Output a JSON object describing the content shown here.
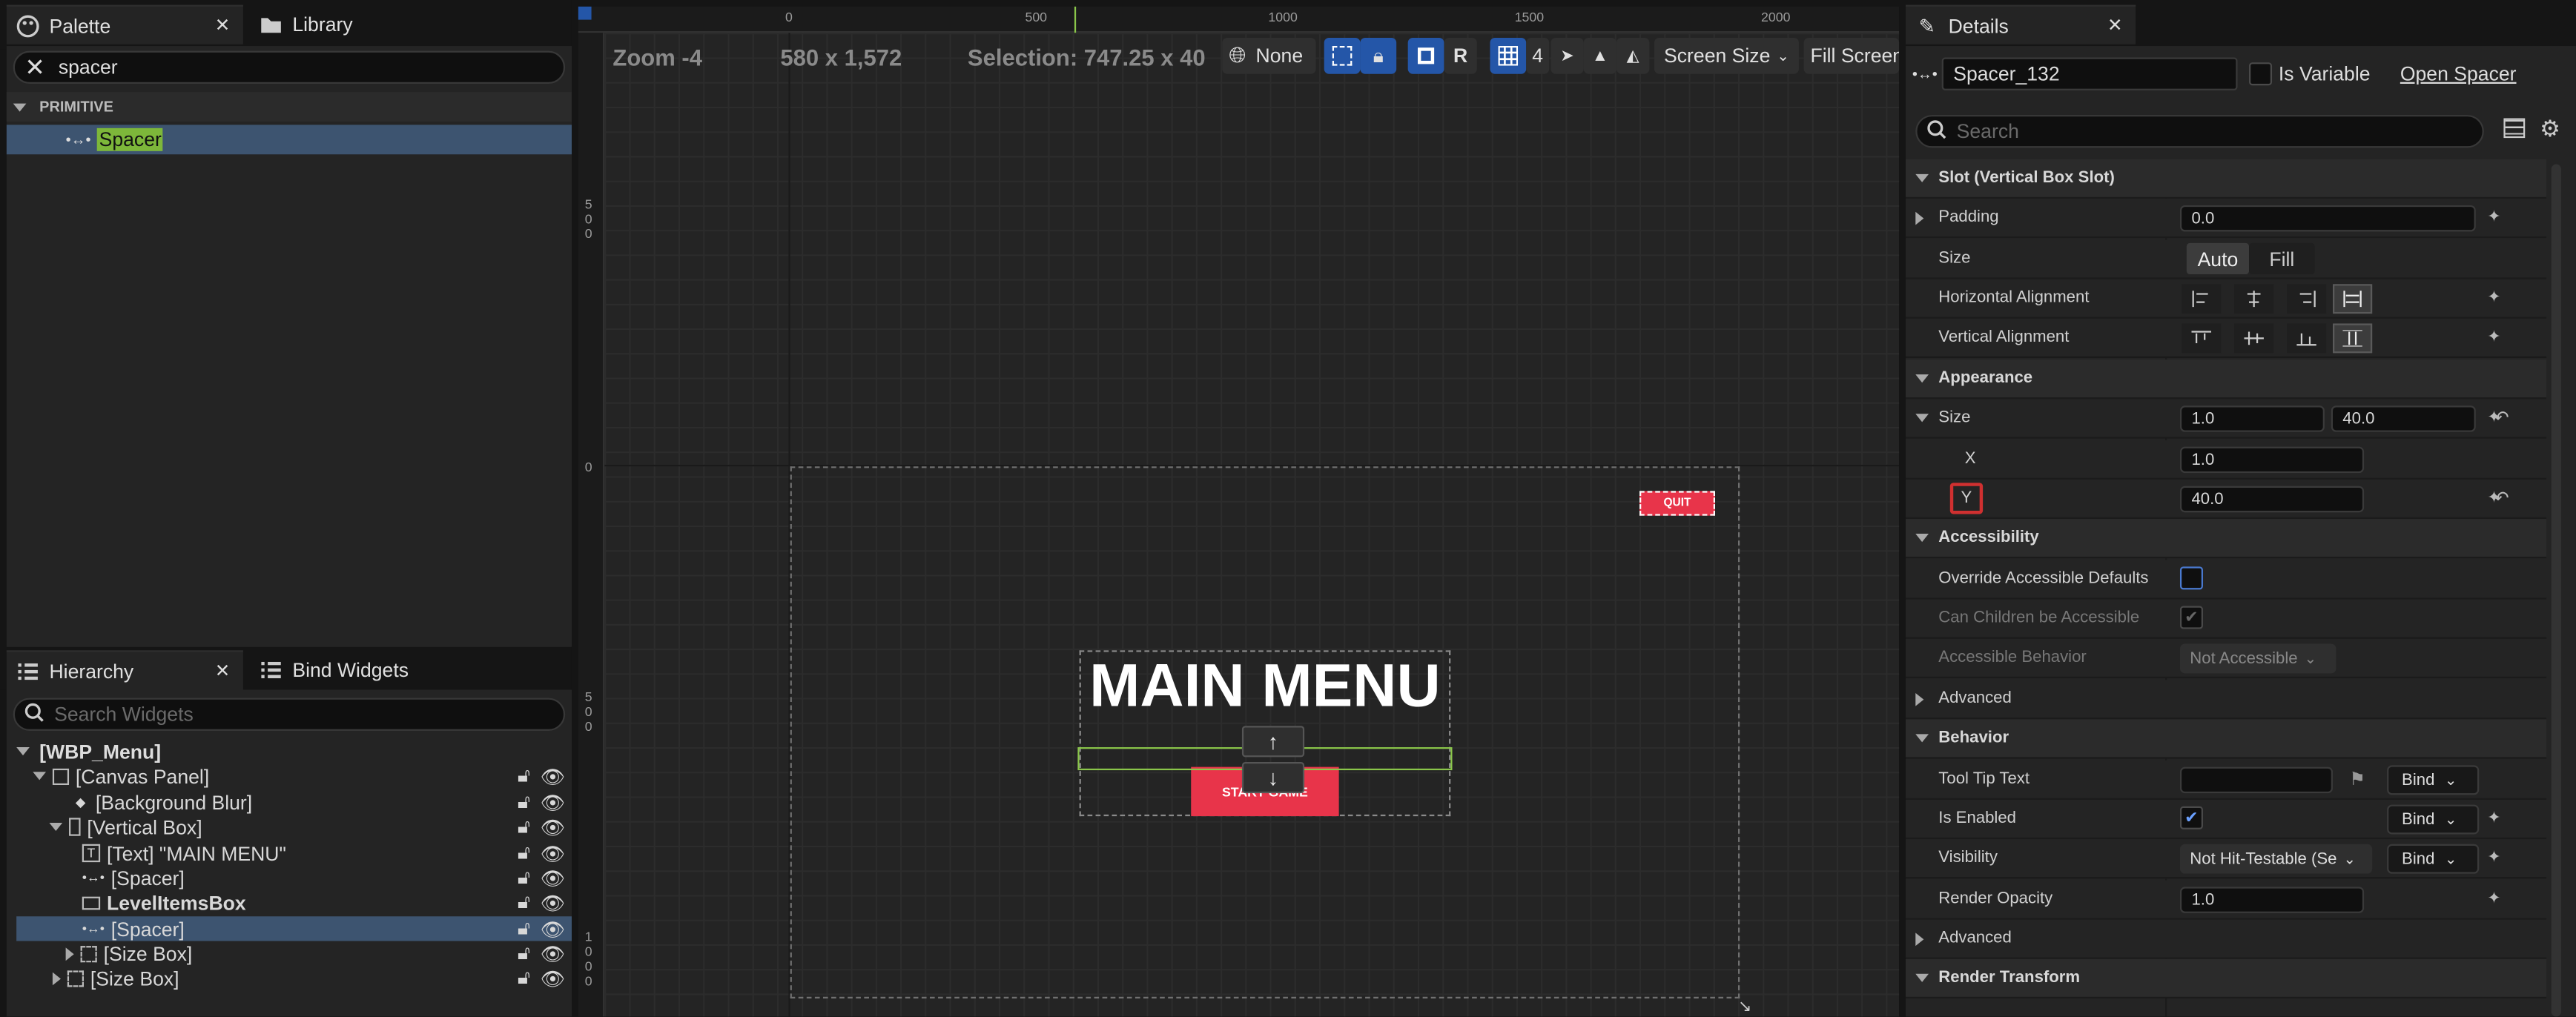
{
  "palette": {
    "tab_label": "Palette",
    "library_label": "Library",
    "search_value": "spacer",
    "category": "PRIMITIVE",
    "result_item": "Spacer"
  },
  "hierarchy": {
    "tab_label": "Hierarchy",
    "bind_widgets_label": "Bind Widgets",
    "search_placeholder": "Search Widgets",
    "root": "[WBP_Menu]",
    "items": [
      {
        "label": "[Canvas Panel]"
      },
      {
        "label": "[Background Blur]"
      },
      {
        "label": "[Vertical Box]"
      },
      {
        "label": "[Text] \"MAIN MENU\""
      },
      {
        "label": "[Spacer]"
      },
      {
        "label": "LevelItemsBox"
      },
      {
        "label": "[Spacer]"
      },
      {
        "label": "[Size Box]"
      },
      {
        "label": "[Size Box]"
      }
    ]
  },
  "designer": {
    "zoom": "Zoom -4",
    "resolution": "580 x 1,572",
    "selection": "Selection: 747.25 x 40",
    "none_label": "None",
    "r_label": "R",
    "grid_count": "4",
    "screen_size": "Screen Size",
    "fill_screen": "Fill Screen",
    "ruler_top": [
      "0",
      "500",
      "1000",
      "1500",
      "2000"
    ],
    "ruler_left_a": [
      "5",
      "0",
      "0"
    ],
    "ruler_left_b": [
      "0"
    ],
    "ruler_left_c": [
      "5",
      "0",
      "0"
    ],
    "ruler_left_d": [
      "1",
      "0",
      "0",
      "0"
    ],
    "canvas": {
      "quit_label": "QUIT",
      "main_title": "MAIN MENU",
      "start_label": "START GAME",
      "up_arrow": "↑",
      "down_arrow": "↓"
    }
  },
  "details": {
    "tab_label": "Details",
    "name_value": "Spacer_132",
    "is_variable": "Is Variable",
    "open_link": "Open Spacer",
    "search_placeholder": "Search",
    "sections": {
      "slot": "Slot (Vertical Box Slot)",
      "appearance": "Appearance",
      "accessibility": "Accessibility",
      "behavior": "Behavior",
      "render_transform": "Render Transform"
    },
    "rows": {
      "padding": "Padding",
      "padding_value": "0.0",
      "size": "Size",
      "size_auto": "Auto",
      "size_fill": "Fill",
      "h_align": "Horizontal Alignment",
      "v_align": "Vertical Alignment",
      "app_size": "Size",
      "app_size_x": "1.0",
      "app_size_y": "40.0",
      "x_label": "X",
      "x_value": "1.0",
      "y_label": "Y",
      "y_value": "40.0",
      "override_acc": "Override Accessible Defaults",
      "children_acc": "Can Children be Accessible",
      "acc_behavior": "Accessible Behavior",
      "acc_behavior_value": "Not Accessible",
      "advanced": "Advanced",
      "tooltip": "Tool Tip Text",
      "enabled": "Is Enabled",
      "visibility": "Visibility",
      "visibility_value": "Not Hit-Testable (Se",
      "render_opacity": "Render Opacity",
      "render_opacity_value": "1.0",
      "advanced2": "Advanced",
      "bind": "Bind"
    }
  },
  "colors": {
    "accent_blue": "#2456a8",
    "selection_row": "#3d5470",
    "button_red": "#e8344a",
    "highlight_green": "#8ac64a"
  }
}
